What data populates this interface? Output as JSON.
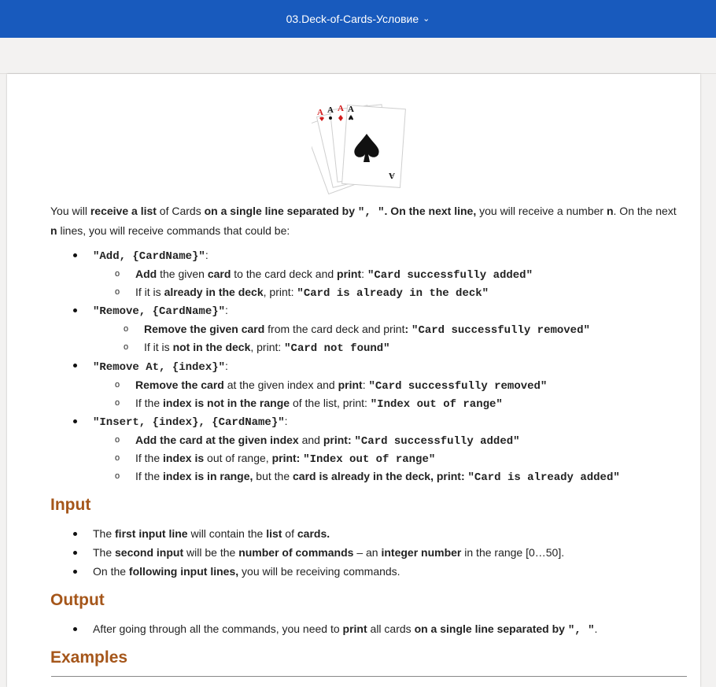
{
  "window": {
    "title": "03.Deck-of-Cards-Условие"
  },
  "intro": {
    "p1": "You will ",
    "p2": "receive a list",
    "p3": " of Cards ",
    "p4": "on a single line separated by ",
    "p5": "\", \"",
    "p6": ". On the ",
    "p7": "next line,",
    "p8": " you will receive a number ",
    "p9": "n",
    "p10": ". On the next ",
    "p11": "n",
    "p12": " lines, you will receive commands that could be:"
  },
  "commands": [
    {
      "name": "\"Add, {CardName}\"",
      "suffix": ":"
    },
    {
      "name": "\"Remove, {CardName}\"",
      "suffix": ":"
    },
    {
      "name": "\"Remove At, {index}\"",
      "suffix": ":"
    },
    {
      "name": "\"Insert, {index}, {CardName}\"",
      "suffix": ":"
    }
  ],
  "sub": {
    "add1": {
      "a": "Add",
      "b": " the given ",
      "c": "card",
      "d": " to the card deck and ",
      "e": "print",
      "f": ": ",
      "g": "\"Card successfully added\""
    },
    "add2": {
      "a": "If it is ",
      "b": "already in the deck",
      "c": ", print: ",
      "d": "\"Card is already in the deck\""
    },
    "rem1": {
      "a": "Remove the given card",
      "b": " from the card deck and print",
      "c": ": ",
      "d": "\"Card successfully removed\""
    },
    "rem2": {
      "a": "If it is ",
      "b": "not in the deck",
      "c": ", print: ",
      "d": "\"Card not found\""
    },
    "rat1": {
      "a": "Remove the card",
      "b": " at the given index and ",
      "c": "print",
      "d": ": ",
      "e": "\"Card successfully removed\""
    },
    "rat2": {
      "a": "If the ",
      "b": "index is not in the range",
      "c": " of the list, print: ",
      "d": "\"Index out of range\""
    },
    "ins1": {
      "a": "Add the card at the given index",
      "b": " and ",
      "c": "print: ",
      "d": "\"Card successfully added\""
    },
    "ins2": {
      "a": "If the ",
      "b": "index is",
      "c": " out of range, ",
      "d": "print: ",
      "e": "\"Index out of range\""
    },
    "ins3": {
      "a": "If the ",
      "b": "index is in range,",
      "c": " but the ",
      "d": "card is already in the deck, print: ",
      "e": "\"Card is already added\""
    }
  },
  "input": {
    "heading": "Input",
    "l1": {
      "a": "The ",
      "b": "first input line",
      "c": " will contain the ",
      "d": "list",
      "e": " of ",
      "f": "cards."
    },
    "l2": {
      "a": "The ",
      "b": "second input",
      "c": " will be the ",
      "d": "number of commands",
      "e": " – an ",
      "f": "integer number",
      "g": " in the range [0…50]."
    },
    "l3": {
      "a": "On the ",
      "b": "following input lines,",
      "c": " you will be receiving commands."
    }
  },
  "output": {
    "heading": "Output",
    "l1": {
      "a": "After going through all the commands, you need to ",
      "b": "print",
      "c": " all cards ",
      "d": "on a single line separated by ",
      "e": "\", \"",
      "f": "."
    }
  },
  "examples": {
    "heading": "Examples"
  },
  "icons": {
    "title_chevron": "chevron-down-icon",
    "cards_image": "four-aces-cards-icon"
  }
}
